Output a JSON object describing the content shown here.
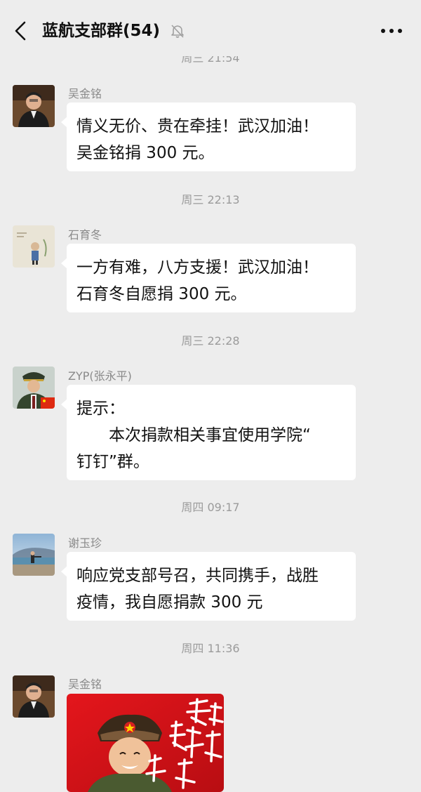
{
  "header": {
    "title": "蓝航支部群(54)"
  },
  "messages": [
    {
      "time": "周三 21:54",
      "sender": "吴金铭",
      "lines": [
        "情义无价、贵在牵挂！武汉加油！",
        "吴金铭捐 300 元。"
      ]
    },
    {
      "time": "周三 22:13",
      "sender": "石育冬",
      "lines": [
        "一方有难，八方支援！武汉加油！",
        "石育冬自愿捐 300 元。"
      ]
    },
    {
      "time": "周三 22:28",
      "sender": "ZYP(张永平)",
      "lines": [
        "提示：",
        "　　本次捐款相关事宜使用学院“",
        "钉钉”群。"
      ]
    },
    {
      "time": "周四 09:17",
      "sender": "谢玉珍",
      "lines": [
        "响应党支部号召，共同携手，战胜",
        "疫情，我自愿捐款 300 元"
      ]
    },
    {
      "time": "周四 11:36",
      "sender": "吴金铭"
    }
  ],
  "colors": {
    "background": "#ededed",
    "bubble": "#ffffff",
    "timestamp": "#9b9b9b",
    "sender": "#8a8a8a"
  }
}
